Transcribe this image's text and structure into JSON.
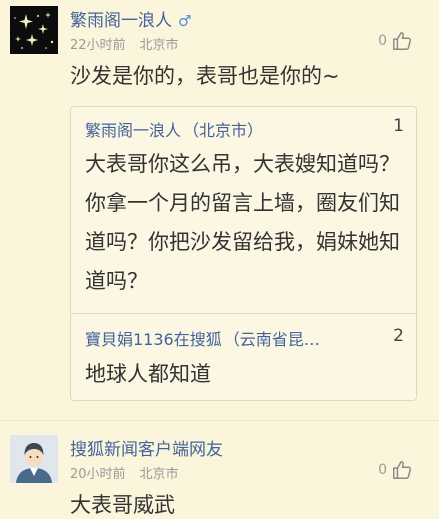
{
  "comments": [
    {
      "username": "繁雨阁一浪人",
      "gender_symbol": "♂",
      "time": "22小时前",
      "location": "北京市",
      "likes": "0",
      "text": "沙发是你的，表哥也是你的~",
      "avatar": "sparkle-stars-avatar",
      "replies": [
        {
          "username": "繁雨阁一浪人",
          "location": "（北京市）",
          "floor": "1",
          "text": "大表哥你这么吊，大表嫂知道吗？你拿一个月的留言上墙，圈友们知道吗？你把沙发留给我，娟妹她知道吗？"
        },
        {
          "username": "寶貝娟1136在搜狐",
          "location": "（云南省昆…",
          "floor": "2",
          "text": "地球人都知道"
        }
      ]
    },
    {
      "username": "搜狐新闻客户端网友",
      "time": "20小时前",
      "location": "北京市",
      "likes": "0",
      "text": "大表哥威武",
      "avatar": "default-user-avatar"
    }
  ],
  "icons": {
    "like": "thumbs-up-icon",
    "gender": "male-icon"
  },
  "colors": {
    "background": "#fbf5dc",
    "username": "#43639a",
    "meta": "#9a9a9a",
    "male": "#4b8fe0"
  }
}
